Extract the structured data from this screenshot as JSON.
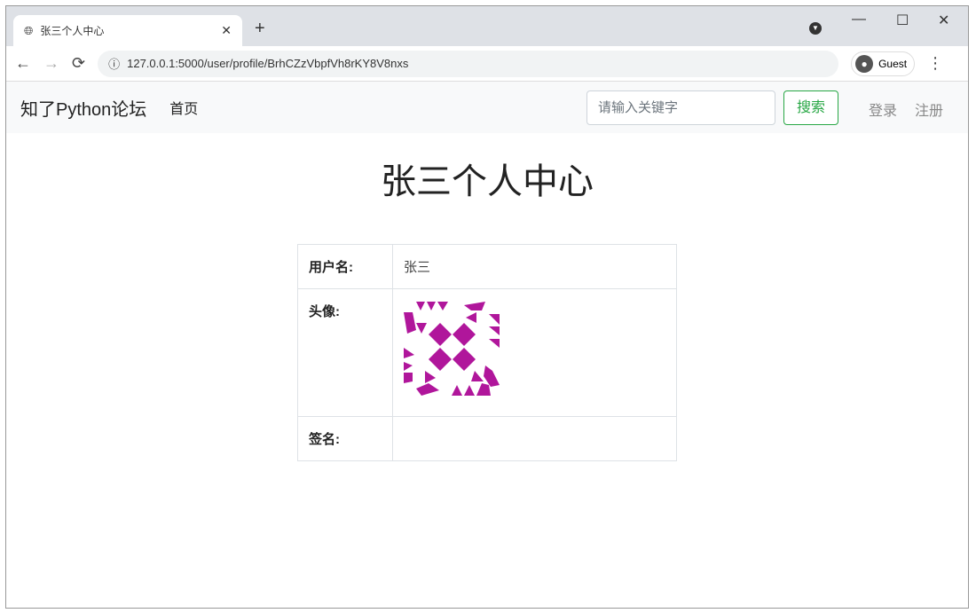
{
  "browser": {
    "tab_title": "张三个人中心",
    "tab_icon": "globe-icon",
    "url": "127.0.0.1:5000/user/profile/BrhCZzVbpfVh8rKY8V8nxs",
    "profile_label": "Guest"
  },
  "navbar": {
    "brand": "知了Python论坛",
    "home": "首页",
    "search_placeholder": "请输入关键字",
    "search_button": "搜索",
    "login": "登录",
    "register": "注册"
  },
  "page": {
    "title": "张三个人中心",
    "rows": [
      {
        "label": "用户名:",
        "value": "张三"
      },
      {
        "label": "头像:",
        "value": ""
      },
      {
        "label": "签名:",
        "value": ""
      }
    ],
    "avatar_color": "#b0169b"
  }
}
